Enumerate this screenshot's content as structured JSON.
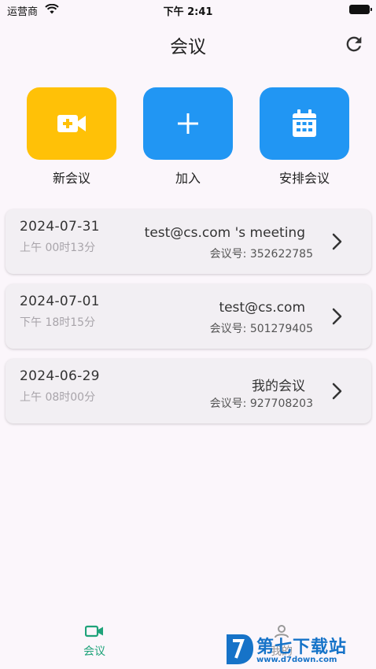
{
  "status_bar": {
    "carrier": "运营商",
    "time": "下午 2:41"
  },
  "nav": {
    "title": "会议"
  },
  "actions": [
    {
      "label": "新会议",
      "icon": "video-plus-icon",
      "color": "#ffc107"
    },
    {
      "label": "加入",
      "icon": "plus-icon",
      "color": "#2196f3"
    },
    {
      "label": "安排会议",
      "icon": "calendar-icon",
      "color": "#2196f3"
    }
  ],
  "meetings": [
    {
      "date": "2024-07-31",
      "time": "上午 00时13分",
      "title": "test@cs.com 's meeting",
      "meeting_id": "会议号: 352622785"
    },
    {
      "date": "2024-07-01",
      "time": "下午 18时15分",
      "title": "test@cs.com",
      "meeting_id": "会议号: 501279405"
    },
    {
      "date": "2024-06-29",
      "time": "上午 08时00分",
      "title": "我的会议",
      "meeting_id": "会议号: 927708203"
    }
  ],
  "tabs": [
    {
      "label": "会议",
      "icon": "video-camera-icon",
      "active": true
    },
    {
      "label": "我的",
      "icon": "person-icon",
      "active": false
    }
  ],
  "watermark": {
    "name": "第七下载站",
    "url": "www.d7down.com"
  },
  "colors": {
    "accent": "#1fa37a",
    "primary": "#2196f3",
    "yellow": "#ffc107"
  }
}
